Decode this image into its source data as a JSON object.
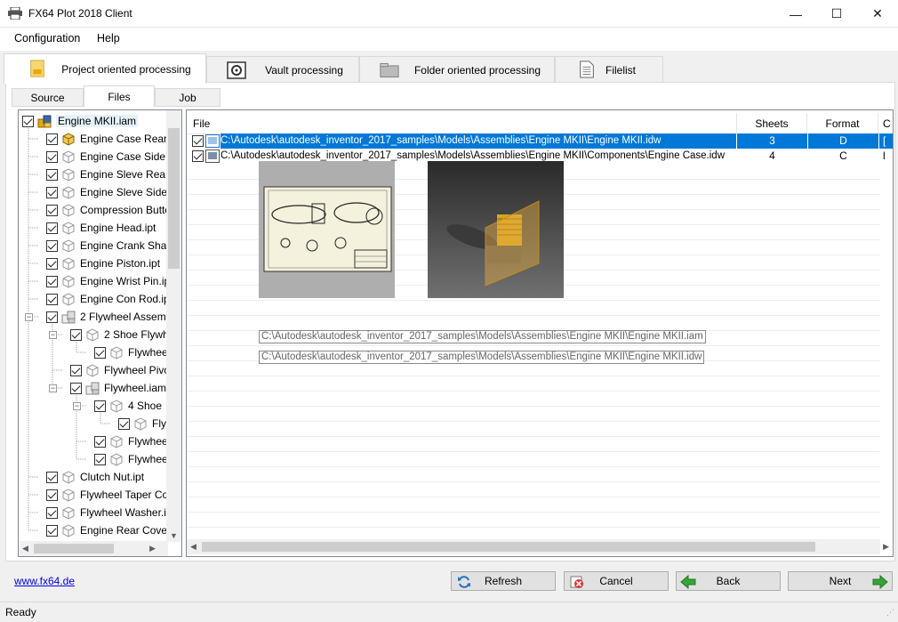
{
  "window": {
    "title": "FX64 Plot 2018 Client",
    "minimize": "—",
    "maximize": "☐",
    "close": "✕"
  },
  "menu": [
    "Configuration",
    "Help"
  ],
  "main_tabs": [
    {
      "label": "Project oriented processing",
      "icon": "project-icon"
    },
    {
      "label": "Vault processing",
      "icon": "vault-icon"
    },
    {
      "label": "Folder oriented processing",
      "icon": "folder-icon"
    },
    {
      "label": "Filelist",
      "icon": "filelist-icon"
    }
  ],
  "sub_tabs": [
    "Source",
    "Files",
    "Job"
  ],
  "tree": [
    {
      "label": "Engine MKII.iam",
      "kind": "asm-root"
    },
    {
      "label": "Engine Case Rear.ip",
      "kind": "part-yellow"
    },
    {
      "label": "Engine Case Side.ip",
      "kind": "part"
    },
    {
      "label": "Engine Sleve Rear.",
      "kind": "part"
    },
    {
      "label": "Engine Sleve Side.i",
      "kind": "part"
    },
    {
      "label": "Compression Button",
      "kind": "part"
    },
    {
      "label": "Engine Head.ipt",
      "kind": "part"
    },
    {
      "label": "Engine Crank Shaft",
      "kind": "part"
    },
    {
      "label": "Engine Piston.ipt",
      "kind": "part"
    },
    {
      "label": "Engine Wrist Pin.ipt",
      "kind": "part"
    },
    {
      "label": "Engine Con Rod.ipt",
      "kind": "part"
    },
    {
      "label": "2 Flywheel Assembl",
      "kind": "asm"
    },
    {
      "label": "2 Shoe Flywhe",
      "kind": "part"
    },
    {
      "label": "Flywhee",
      "kind": "part"
    },
    {
      "label": "Flywheel Pivo",
      "kind": "part"
    },
    {
      "label": "Flywheel.iam",
      "kind": "asm"
    },
    {
      "label": "4 Shoe",
      "kind": "part"
    },
    {
      "label": "Fly",
      "kind": "part"
    },
    {
      "label": "Flywhee",
      "kind": "part"
    },
    {
      "label": "Flywhee",
      "kind": "part"
    },
    {
      "label": "Clutch Nut.ipt",
      "kind": "part"
    },
    {
      "label": "Flywheel Taper Coll",
      "kind": "part"
    },
    {
      "label": "Flywheel Washer.ip",
      "kind": "part"
    },
    {
      "label": "Engine Rear Cover.",
      "kind": "part"
    }
  ],
  "files": {
    "columns": [
      "File",
      "Sheets",
      "Format",
      "C"
    ],
    "rows": [
      {
        "path": "C:\\Autodesk\\autodesk_inventor_2017_samples\\Models\\Assemblies\\Engine MKII\\Engine MKII.idw",
        "sheets": "3",
        "format": "D",
        "extra": "[",
        "selected": true
      },
      {
        "path": "C:\\Autodesk\\autodesk_inventor_2017_samples\\Models\\Assemblies\\Engine MKII\\Components\\Engine Case.idw",
        "sheets": "4",
        "format": "C",
        "extra": "l",
        "selected": false
      }
    ]
  },
  "tooltips": [
    "C:\\Autodesk\\autodesk_inventor_2017_samples\\Models\\Assemblies\\Engine MKII\\Engine MKII.iam",
    "C:\\Autodesk\\autodesk_inventor_2017_samples\\Models\\Assemblies\\Engine MKII\\Engine MKII.idw"
  ],
  "link": "www.fx64.de",
  "buttons": {
    "refresh": "Refresh",
    "cancel": "Cancel",
    "back": "Back",
    "next": "Next"
  },
  "status": "Ready",
  "colors": {
    "selection": "#0078d7",
    "accent_green": "#3aa23a",
    "link": "#0000ee"
  }
}
